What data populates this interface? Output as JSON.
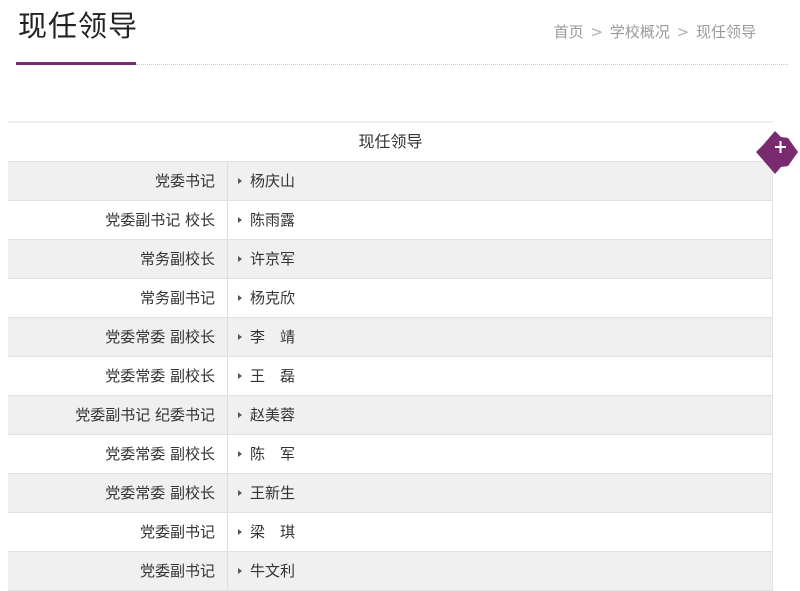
{
  "header": {
    "title": "现任领导",
    "breadcrumb": [
      "首页",
      "学校概况",
      "现任领导"
    ],
    "separator": ">"
  },
  "table": {
    "title": "现任领导",
    "rows": [
      {
        "role": "党委书记",
        "name": "杨庆山"
      },
      {
        "role": "党委副书记 校长",
        "name": "陈雨露"
      },
      {
        "role": "常务副校长",
        "name": "许京军"
      },
      {
        "role": "常务副书记",
        "name": "杨克欣"
      },
      {
        "role": "党委常委 副校长",
        "name": "李　靖"
      },
      {
        "role": "党委常委 副校长",
        "name": "王　磊"
      },
      {
        "role": "党委副书记 纪委书记",
        "name": "赵美蓉"
      },
      {
        "role": "党委常委 副校长",
        "name": "陈　军"
      },
      {
        "role": "党委常委 副校长",
        "name": "王新生"
      },
      {
        "role": "党委副书记",
        "name": "梁　琪"
      },
      {
        "role": "党委副书记",
        "name": "牛文利"
      }
    ]
  },
  "side_button": {
    "icon": "plus-icon",
    "label": "+",
    "color": "#7a2a6e"
  },
  "colors": {
    "accent": "#7a2a6e",
    "row_shade": "#f0f0f0",
    "breadcrumb": "#9a9a9a"
  }
}
